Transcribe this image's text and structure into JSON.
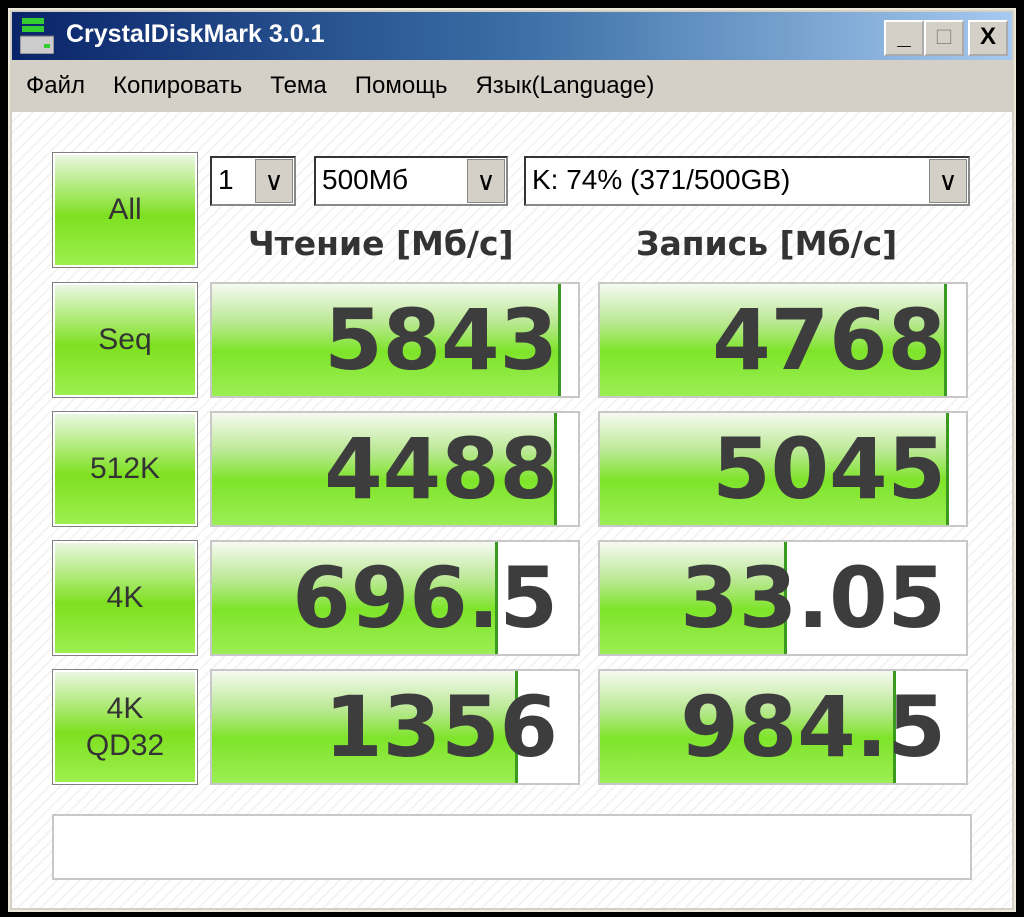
{
  "window": {
    "title": "CrystalDiskMark 3.0.1",
    "minimize": "_",
    "maximize": "□",
    "close": "X"
  },
  "menu": [
    "Файл",
    "Копировать",
    "Тема",
    "Помощь",
    "Язык(Language)"
  ],
  "controls": {
    "all_label": "All",
    "runs": "1",
    "size": "500Мб",
    "drive": "K: 74% (371/500GB)",
    "arrow": "∨"
  },
  "headers": {
    "read": "Чтение [Мб/с]",
    "write": "Запись [Мб/с]"
  },
  "rows": [
    {
      "label": "Seq",
      "read": "5843",
      "write": "4768",
      "read_fill": 0.946,
      "write_fill": 0.94
    },
    {
      "label": "512K",
      "read": "4488",
      "write": "5045",
      "read_fill": 0.935,
      "write_fill": 0.946
    },
    {
      "label": "4K",
      "read": "696.5",
      "write": "33.05",
      "read_fill": 0.773,
      "write_fill": 0.504
    },
    {
      "label": "4K\nQD32",
      "read": "1356",
      "write": "984.5",
      "read_fill": 0.827,
      "write_fill": 0.8
    }
  ],
  "status": ""
}
